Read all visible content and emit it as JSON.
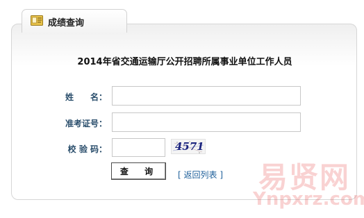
{
  "tab": {
    "title": "成绩查询",
    "icon": "report-card-icon"
  },
  "form": {
    "heading": "2014年省交通运输厅公开招聘所属事业单位工作人员",
    "fields": [
      {
        "label": "姓　　名：",
        "value": "",
        "placeholder": ""
      },
      {
        "label": "准考证号：",
        "value": "",
        "placeholder": ""
      },
      {
        "label": "校 验 码：",
        "value": "",
        "placeholder": ""
      }
    ],
    "captcha_text": "4571",
    "submit_label": "查 询",
    "back_link_label": "返回列表",
    "back_link_open": "[",
    "back_link_close": "]"
  },
  "watermark": {
    "logo_text": "易贤网",
    "url_text": "Ynpxrz.com",
    "color": "#e53935"
  }
}
